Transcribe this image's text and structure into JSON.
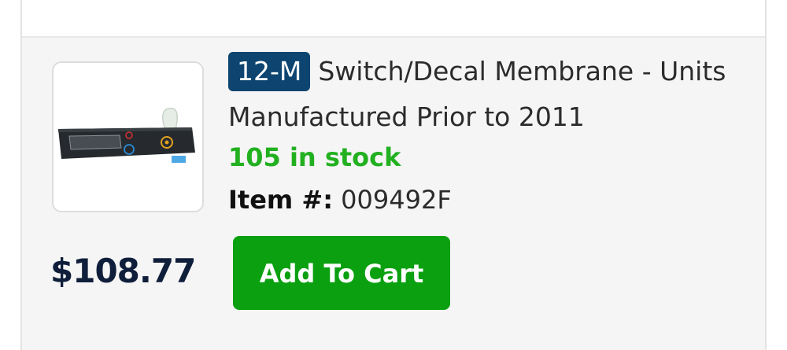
{
  "product": {
    "model_badge": "12-M",
    "title": "Switch/Decal Membrane - Units Manufactured Prior to 2011",
    "stock_text": "105 in stock",
    "item_label": "Item #:",
    "item_number": "009492F",
    "price": "$108.77",
    "add_to_cart_label": "Add To Cart",
    "image_alt": "Switch/Decal Membrane",
    "colors": {
      "badge_bg": "#0d4570",
      "stock_green": "#22b020",
      "button_green": "#0aa010",
      "price_navy": "#0f1e3a"
    }
  }
}
